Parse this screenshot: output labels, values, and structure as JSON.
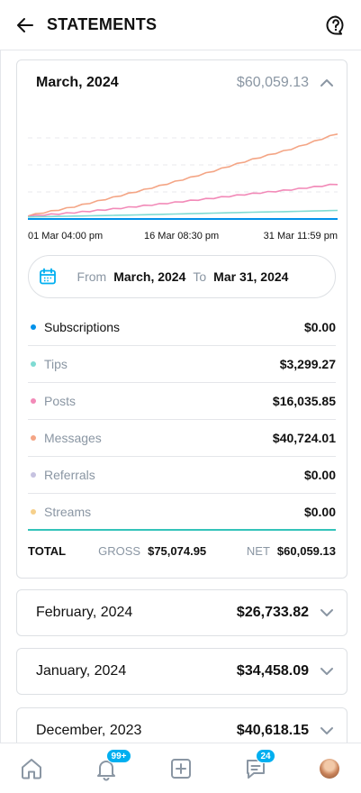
{
  "header": {
    "title": "STATEMENTS"
  },
  "current": {
    "month": "March, 2024",
    "total": "$60,059.13",
    "axis": [
      "01 Mar 04:00 pm",
      "16 Mar 08:30 pm",
      "31 Mar 11:59 pm"
    ],
    "range": {
      "from_label": "From",
      "from": "March, 2024",
      "to_label": "To",
      "to": "Mar 31, 2024"
    },
    "rows": [
      {
        "label": "Subscriptions",
        "value": "$0.00",
        "color": "#0091ea"
      },
      {
        "label": "Tips",
        "value": "$3,299.27",
        "color": "#7fdbd3"
      },
      {
        "label": "Posts",
        "value": "$16,035.85",
        "color": "#f28ab8"
      },
      {
        "label": "Messages",
        "value": "$40,724.01",
        "color": "#f4a585"
      },
      {
        "label": "Referrals",
        "value": "$0.00",
        "color": "#c6c2e0"
      },
      {
        "label": "Streams",
        "value": "$0.00",
        "color": "#f6d08b"
      }
    ],
    "totals": {
      "label": "TOTAL",
      "gross_label": "GROSS",
      "gross": "$75,074.95",
      "net_label": "NET",
      "net": "$60,059.13"
    }
  },
  "past": [
    {
      "month": "February, 2024",
      "total": "$26,733.82"
    },
    {
      "month": "January, 2024",
      "total": "$34,458.09"
    },
    {
      "month": "December, 2023",
      "total": "$40,618.15"
    }
  ],
  "tabbar": {
    "notifications_badge": "99+",
    "messages_badge": "24"
  },
  "chart_data": {
    "type": "area",
    "x": [
      "01 Mar 04:00 pm",
      "16 Mar 08:30 pm",
      "31 Mar 11:59 pm"
    ],
    "series": [
      {
        "name": "Messages",
        "color": "#f4a585",
        "values": [
          0.5,
          4.6,
          9.8,
          15.2,
          21.1,
          27.6,
          33.4,
          40.7
        ]
      },
      {
        "name": "Posts",
        "color": "#f28ab8",
        "values": [
          0.2,
          1.9,
          3.9,
          6.2,
          8.6,
          11.1,
          13.3,
          16.0
        ]
      },
      {
        "name": "Tips",
        "color": "#7fdbd3",
        "values": [
          0.1,
          0.5,
          0.9,
          1.4,
          1.9,
          2.4,
          2.8,
          3.3
        ]
      },
      {
        "name": "Subscriptions",
        "color": "#0091ea",
        "values": [
          0,
          0,
          0,
          0,
          0,
          0,
          0,
          0
        ]
      }
    ],
    "grid": "dashed horizontal"
  }
}
